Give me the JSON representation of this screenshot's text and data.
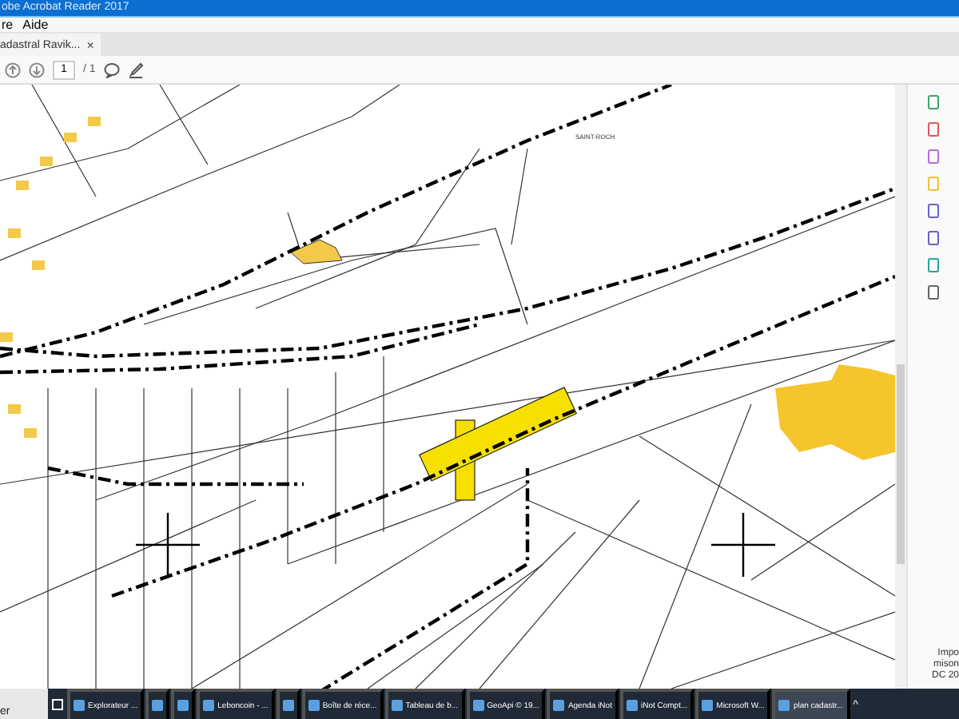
{
  "window": {
    "title": "obe Acrobat Reader 2017"
  },
  "menu": [
    "re",
    "Aide"
  ],
  "tab": {
    "label": "adastral Ravik...",
    "close": "×"
  },
  "toolbar": {
    "page": "1",
    "total": "/ 1"
  },
  "map": {
    "place_label": "SAINT-ROCH"
  },
  "right_panel": {
    "note": [
      "Impo",
      "mison",
      "DC 20"
    ]
  },
  "taskbar": {
    "search_text": "er",
    "items": [
      {
        "label": "Explorateur ...",
        "selected": false
      },
      {
        "selected": false
      },
      {
        "selected": false
      },
      {
        "label": "Leboncoin - ...",
        "selected": false
      },
      {
        "selected": false
      },
      {
        "label": "Boîte de réce...",
        "selected": false
      },
      {
        "label": "Tableau de b...",
        "selected": false
      },
      {
        "label": "GeoApi © 19...",
        "selected": false
      },
      {
        "label": "Agenda iNot",
        "selected": false
      },
      {
        "label": "iNot Compt...",
        "selected": false
      },
      {
        "label": "Microsoft W...",
        "selected": false
      },
      {
        "label": "plan cadastr...",
        "selected": true
      }
    ],
    "tray": "^"
  }
}
